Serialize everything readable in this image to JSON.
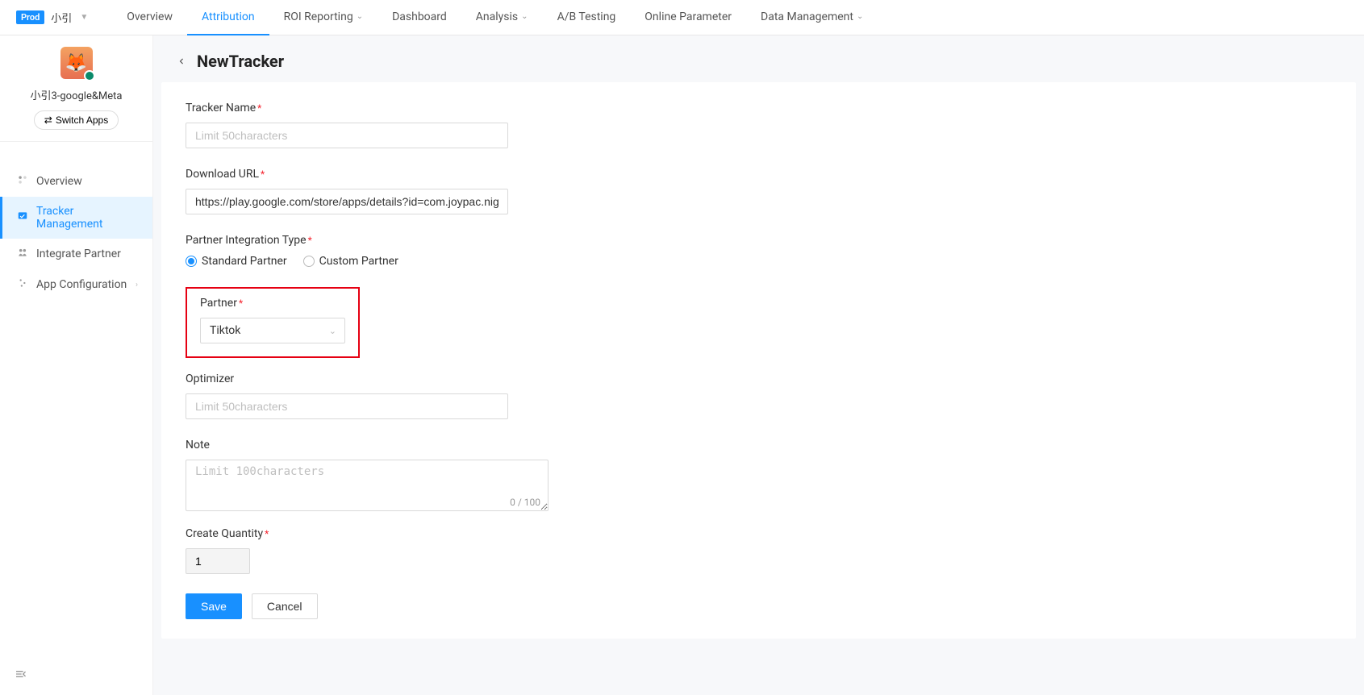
{
  "header": {
    "env_badge": "Prod",
    "app_short_name": "小引"
  },
  "top_menu": [
    {
      "label": "Overview",
      "has_dropdown": false,
      "active": false
    },
    {
      "label": "Attribution",
      "has_dropdown": false,
      "active": true
    },
    {
      "label": "ROI Reporting",
      "has_dropdown": true,
      "active": false
    },
    {
      "label": "Dashboard",
      "has_dropdown": false,
      "active": false
    },
    {
      "label": "Analysis",
      "has_dropdown": true,
      "active": false
    },
    {
      "label": "A/B Testing",
      "has_dropdown": false,
      "active": false
    },
    {
      "label": "Online Parameter",
      "has_dropdown": false,
      "active": false
    },
    {
      "label": "Data Management",
      "has_dropdown": true,
      "active": false
    }
  ],
  "sidebar": {
    "app_name": "小引3-google&Meta",
    "switch_label": "Switch Apps",
    "items": [
      {
        "label": "Overview",
        "icon": "overview-icon",
        "active": false,
        "has_sub": false
      },
      {
        "label": "Tracker Management",
        "icon": "tracker-icon",
        "active": true,
        "has_sub": false
      },
      {
        "label": "Integrate Partner",
        "icon": "partner-icon",
        "active": false,
        "has_sub": false
      },
      {
        "label": "App Configuration",
        "icon": "settings-icon",
        "active": false,
        "has_sub": true
      }
    ]
  },
  "page": {
    "title": "NewTracker"
  },
  "form": {
    "tracker_name": {
      "label": "Tracker Name",
      "placeholder": "Limit 50characters",
      "value": ""
    },
    "download_url": {
      "label": "Download URL",
      "value": "https://play.google.com/store/apps/details?id=com.joypac.nigenek"
    },
    "partner_integration_type": {
      "label": "Partner Integration Type",
      "options": [
        {
          "label": "Standard Partner",
          "selected": true
        },
        {
          "label": "Custom Partner",
          "selected": false
        }
      ]
    },
    "partner": {
      "label": "Partner",
      "value": "Tiktok"
    },
    "optimizer": {
      "label": "Optimizer",
      "placeholder": "Limit 50characters",
      "value": ""
    },
    "note": {
      "label": "Note",
      "placeholder": "Limit 100characters",
      "value": "",
      "counter": "0 / 100"
    },
    "create_quantity": {
      "label": "Create Quantity",
      "value": "1"
    }
  },
  "buttons": {
    "save": "Save",
    "cancel": "Cancel"
  }
}
